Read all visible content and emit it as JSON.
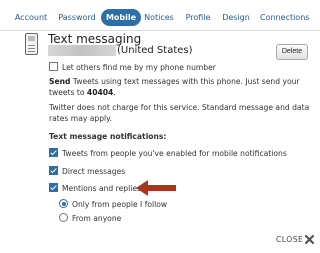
{
  "tabs": [
    {
      "label": "Account",
      "active": false
    },
    {
      "label": "Password",
      "active": false
    },
    {
      "label": "Mobile",
      "active": true
    },
    {
      "label": "Notices",
      "active": false
    },
    {
      "label": "Profile",
      "active": false
    },
    {
      "label": "Design",
      "active": false
    },
    {
      "label": "Connections",
      "active": false
    }
  ],
  "phone": {
    "title": "Text messaging",
    "country": "(United States)",
    "delete_label": "Delete",
    "let_others_label": "Let others find me by my phone number",
    "let_others_checked": false
  },
  "info": {
    "send_bold": "Send",
    "send_text": " Tweets using text messages with this phone. Just send your tweets to ",
    "shortcode": "40404",
    "send_end": ".",
    "charge_text": "Twitter does not charge for this service. Standard message and data rates may apply."
  },
  "notifications": {
    "heading": "Text message notifications:",
    "tweets_label": "Tweets from people you've enabled for mobile notifications",
    "direct_label": "Direct messages",
    "mentions_label": "Mentions and replies",
    "only_follow_label": "Only from people I follow",
    "anyone_label": "From anyone"
  },
  "close_label": "CLOSE",
  "icons": [
    "phone-icon",
    "checkbox-checked-icon",
    "radio-selected-icon",
    "arrow-icon",
    "close-x-icon"
  ],
  "colors": {
    "accent": "#2f6fa8",
    "arrow": "#a8361f",
    "tab_text": "#2a5a8a"
  }
}
